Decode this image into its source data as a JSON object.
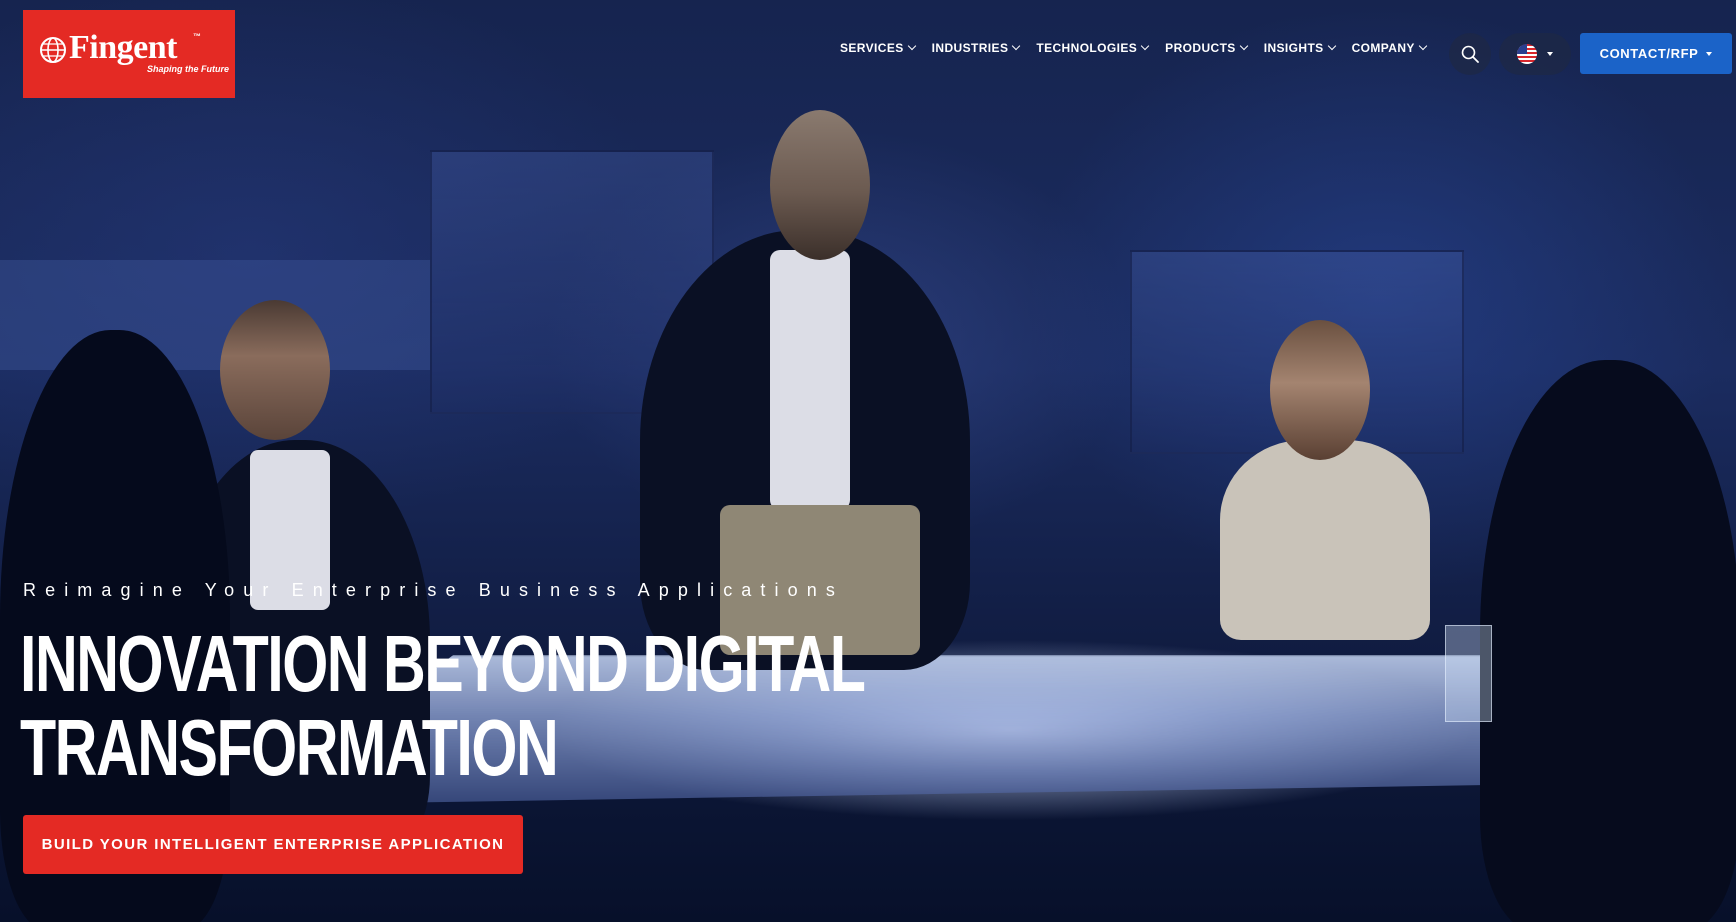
{
  "brand": {
    "name": "Fingent",
    "trademark": "™",
    "tagline": "Shaping the Future",
    "color": "#e42a24"
  },
  "nav": {
    "items": [
      {
        "label": "SERVICES"
      },
      {
        "label": "INDUSTRIES"
      },
      {
        "label": "TECHNOLOGIES"
      },
      {
        "label": "PRODUCTS"
      },
      {
        "label": "INSIGHTS"
      },
      {
        "label": "COMPANY"
      }
    ],
    "search_icon": "search-icon",
    "language_icon": "us-flag-icon",
    "contact_label": "CONTACT/RFP",
    "contact_color": "#1b63c8"
  },
  "hero": {
    "tagline": "Reimagine Your Enterprise Business Applications",
    "headline_line1": "INNOVATION BEYOND DIGITAL",
    "headline_line2": "TRANSFORMATION",
    "cta_label": "BUILD YOUR INTELLIGENT ENTERPRISE APPLICATION"
  }
}
